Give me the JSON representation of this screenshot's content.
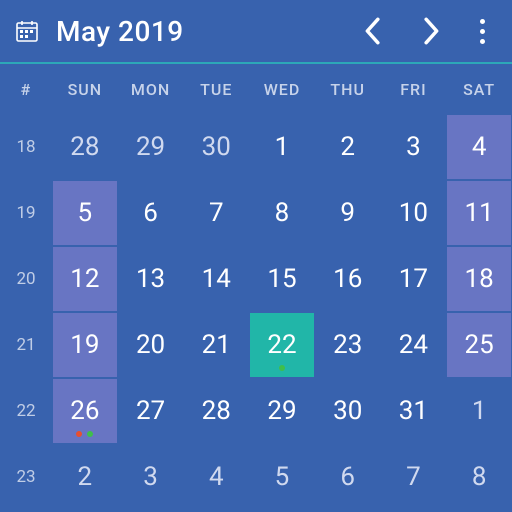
{
  "header": {
    "title": "May 2019"
  },
  "dow_header": "#",
  "dow": [
    "SUN",
    "MON",
    "TUE",
    "WED",
    "THU",
    "FRI",
    "SAT"
  ],
  "weeks": [
    {
      "num": "18",
      "days": [
        {
          "d": "28",
          "other": true
        },
        {
          "d": "29",
          "other": true
        },
        {
          "d": "30",
          "other": true
        },
        {
          "d": "1"
        },
        {
          "d": "2"
        },
        {
          "d": "3"
        },
        {
          "d": "4",
          "weekend": true
        }
      ]
    },
    {
      "num": "19",
      "days": [
        {
          "d": "5",
          "weekend": true
        },
        {
          "d": "6"
        },
        {
          "d": "7"
        },
        {
          "d": "8"
        },
        {
          "d": "9"
        },
        {
          "d": "10"
        },
        {
          "d": "11",
          "weekend": true
        }
      ]
    },
    {
      "num": "20",
      "days": [
        {
          "d": "12",
          "weekend": true
        },
        {
          "d": "13"
        },
        {
          "d": "14"
        },
        {
          "d": "15"
        },
        {
          "d": "16"
        },
        {
          "d": "17"
        },
        {
          "d": "18",
          "weekend": true
        }
      ]
    },
    {
      "num": "21",
      "days": [
        {
          "d": "19",
          "weekend": true
        },
        {
          "d": "20"
        },
        {
          "d": "21"
        },
        {
          "d": "22",
          "today": true,
          "dots": [
            "#3fbf4a"
          ]
        },
        {
          "d": "23"
        },
        {
          "d": "24"
        },
        {
          "d": "25",
          "weekend": true
        }
      ]
    },
    {
      "num": "22",
      "days": [
        {
          "d": "26",
          "weekend": true,
          "dots": [
            "#e84f2f",
            "#3fbf4a"
          ]
        },
        {
          "d": "27"
        },
        {
          "d": "28"
        },
        {
          "d": "29"
        },
        {
          "d": "30"
        },
        {
          "d": "31"
        },
        {
          "d": "1",
          "other": true
        }
      ]
    },
    {
      "num": "23",
      "days": [
        {
          "d": "2",
          "other": true
        },
        {
          "d": "3",
          "other": true
        },
        {
          "d": "4",
          "other": true
        },
        {
          "d": "5",
          "other": true
        },
        {
          "d": "6",
          "other": true
        },
        {
          "d": "7",
          "other": true
        },
        {
          "d": "8",
          "other": true
        }
      ]
    }
  ]
}
